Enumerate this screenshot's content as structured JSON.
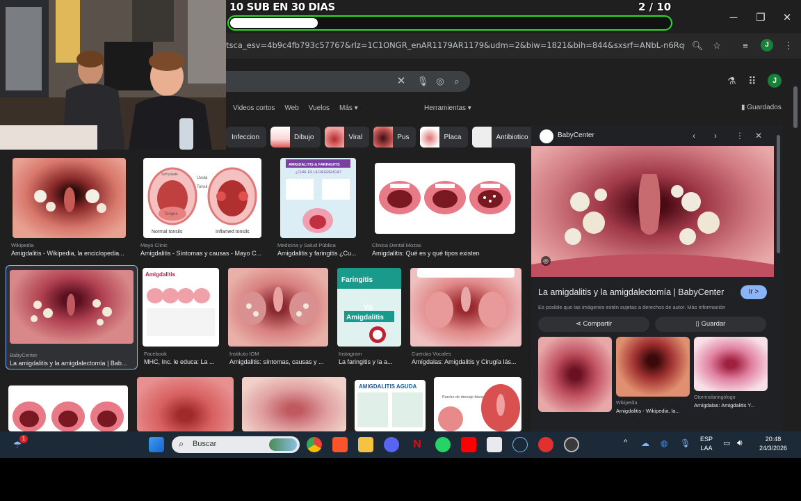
{
  "overlay": {
    "title": "10 SUB EN 30 DIAS",
    "count": "2  / 10",
    "progress_fraction": 0.2
  },
  "browser": {
    "url": "tsca_esv=4b9c4fb793c57767&rlz=1C1ONGR_enAR1179AR1179&udm=2&biw=1821&bih=844&sxsrf=ANbL-n6RqC-OEOkNF...",
    "profile_initial": "J"
  },
  "google": {
    "profile_initial": "J",
    "tabs": [
      "Videos cortos",
      "Web",
      "Vuelos",
      "Más ▾"
    ],
    "tools": "Herramientas ▾",
    "saved": "Guardados",
    "chips": [
      "Infeccion",
      "Dibujo",
      "Viral",
      "Pus",
      "Placa",
      "Antibiotico"
    ]
  },
  "results": [
    {
      "source": "Wikipedia",
      "title": "Amigdalitis - Wikipedia, la enciclopedia..."
    },
    {
      "source": "Mayo Clinic",
      "title": "Amigdalitis - Síntomas y causas - Mayo C..."
    },
    {
      "source": "Medicina y Salud Pública",
      "title": "Amigdalitis y faringitis ¿Cu..."
    },
    {
      "source": "Clínica Dental Mozas",
      "title": "Amigdalitis: Qué es y qué tipos existen"
    },
    {
      "source": "BabyCenter",
      "title": "La amigdalitis y la amigdalectomía | Bab..."
    },
    {
      "source": "Facebook",
      "title": "MHC, Inc. le educa: La ..."
    },
    {
      "source": "Instituto IOM",
      "title": "Amigdalitis: síntomas, causas y ..."
    },
    {
      "source": "Instagram",
      "title": "La faringitis y la a..."
    },
    {
      "source": "Cuerdas Vocales",
      "title": "Amígdalas: Amigdalitis y Cirugía lás..."
    }
  ],
  "thumb_labels": {
    "uvula": "Uvula",
    "tonsil": "Tonsil",
    "tongue": "Tongue",
    "soft_palate": "Soft palate",
    "normal": "Normal tonsils",
    "inflamed": "Inflamed tonsils",
    "amig_far": "AMIGDALITIS & FARINGITIS",
    "diferencia": "¿CUÁL ES LA DIFERENCIA?",
    "amigdalitis": "Amigdalitis",
    "faringitis": "Faringitis",
    "vs": "VS",
    "amigdalitis2": "Amigdalitis",
    "aguda": "AMIGDALITIS AGUDA",
    "parche": "Parche de drenaje blanco"
  },
  "panel": {
    "site": "BabyCenter",
    "title": "La amigdalitis y la amigdalectomía | BabyCenter",
    "visit": "Ir >",
    "copyright": "Es posible que las imágenes estén sujetas a derechos de autor. Más información",
    "share": "Compartir",
    "save": "Guardar",
    "related": [
      {
        "source": "Wikipedia",
        "title": "Amigdalitis - Wikipedia, la..."
      },
      {
        "source": "Otorrinolaringólogo",
        "title": "Amígdalas: Amigdalitis Y..."
      }
    ]
  },
  "taskbar": {
    "search_label": "Buscar",
    "lang1": "ESP",
    "lang2": "LAA",
    "time": "20:48",
    "date": "24/3/2026",
    "badge": "1"
  }
}
